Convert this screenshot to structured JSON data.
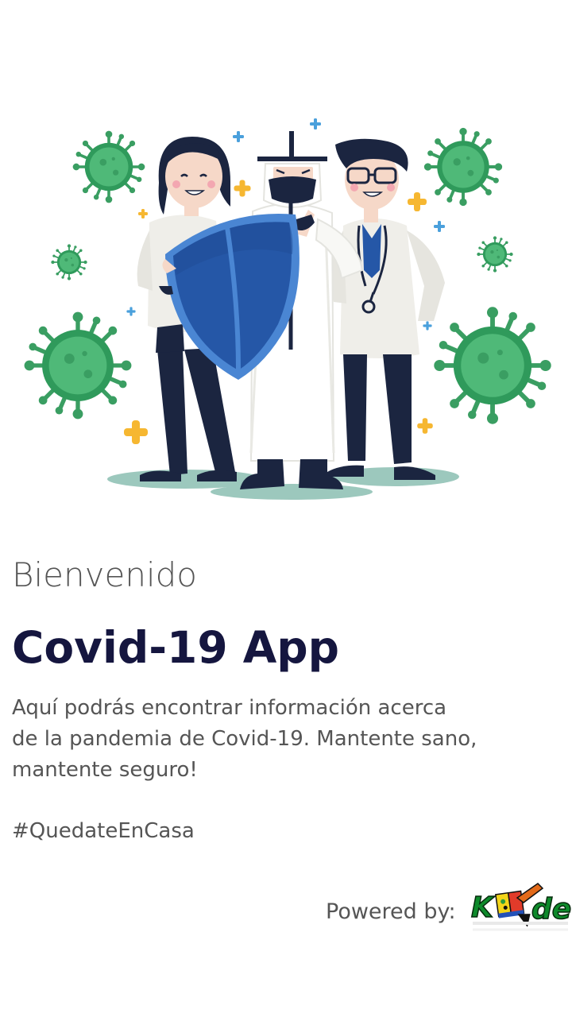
{
  "splash": {
    "welcome": "Bienvenido",
    "app_title": "Covid-19 App",
    "description_lines": [
      "Aquí podrás encontrar información acerca",
      "de la pandemia de Covid-19. Mantente sano,",
      "mantente seguro!"
    ],
    "hashtag": "#QuedateEnCasa",
    "powered_by": "Powered by:",
    "brand_logo_text": "Kidde"
  },
  "illustration": {
    "subject": "healthcare-workers-with-shield-and-viruses",
    "icons": [
      "virus-icon",
      "plus-sparkle-icon",
      "shield-icon",
      "stethoscope-icon"
    ]
  },
  "colors": {
    "title": "#15163f",
    "body_text": "#555555",
    "virus_green": "#3dab6c",
    "shield_blue": "#2557a7",
    "sparkle_yellow": "#f6b731",
    "sparkle_blue": "#4aa0dc"
  }
}
